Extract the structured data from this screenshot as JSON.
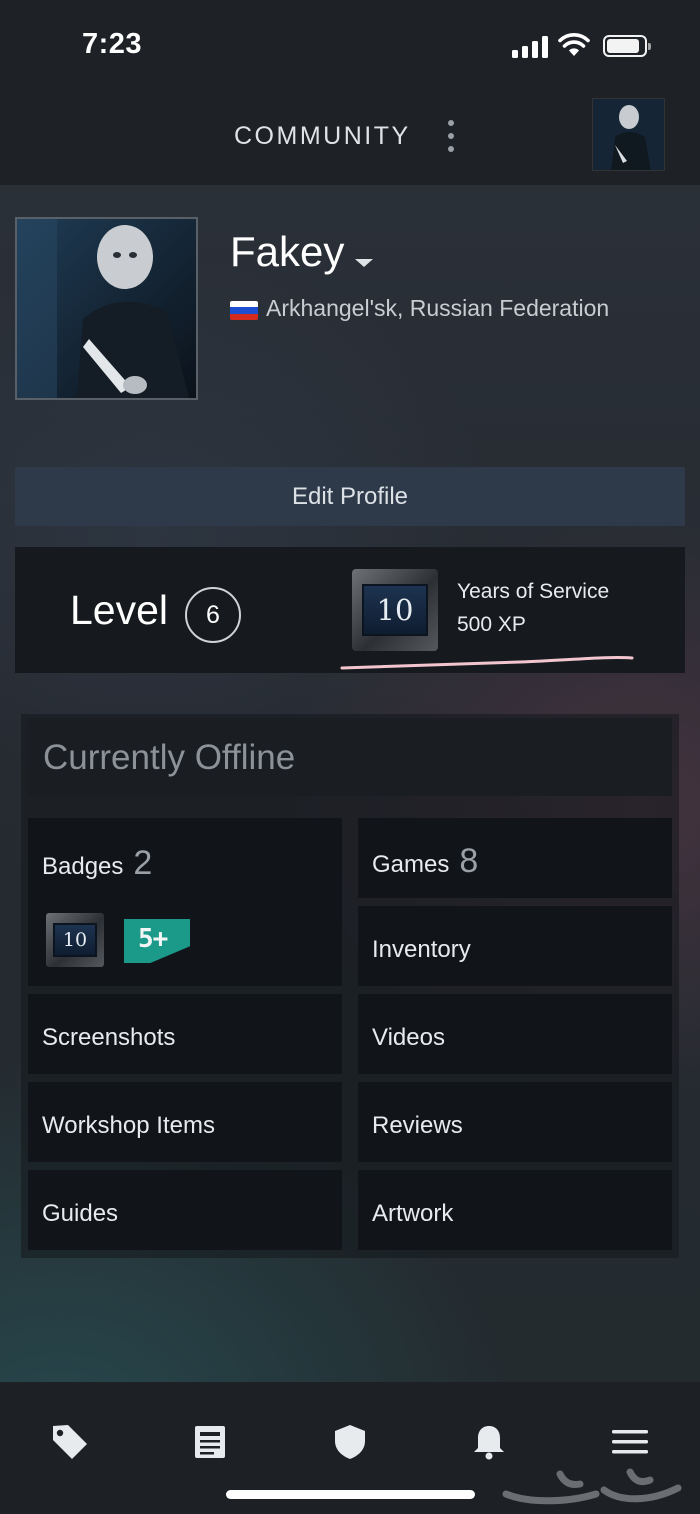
{
  "status_bar": {
    "time": "7:23",
    "signal_icon": "cellular-signal-icon",
    "wifi_icon": "wifi-icon",
    "battery_icon": "battery-icon"
  },
  "header": {
    "title": "COMMUNITY",
    "menu_icon": "kebab-menu-icon"
  },
  "profile": {
    "username": "Fakey",
    "location": "Arkhangel'sk, Russian Federation",
    "flag_colors": [
      "#ffffff",
      "#1f4fd1",
      "#d52b1e"
    ],
    "edit_button": "Edit Profile"
  },
  "level": {
    "label": "Level",
    "value": "6",
    "badge_number": "10",
    "badge_title": "Years of Service",
    "badge_xp": "500 XP"
  },
  "status": {
    "text": "Currently Offline"
  },
  "tiles": {
    "badges": {
      "label": "Badges",
      "count": "2",
      "badge_a": "10",
      "badge_b": "5+"
    },
    "games": {
      "label": "Games",
      "count": "8"
    },
    "inventory": {
      "label": "Inventory"
    },
    "screenshots": {
      "label": "Screenshots"
    },
    "videos": {
      "label": "Videos"
    },
    "workshop": {
      "label": "Workshop Items"
    },
    "reviews": {
      "label": "Reviews"
    },
    "guides": {
      "label": "Guides"
    },
    "artwork": {
      "label": "Artwork"
    }
  },
  "bottom_nav": {
    "items": [
      "tag-icon",
      "news-icon",
      "shield-icon",
      "bell-icon",
      "hamburger-menu-icon"
    ]
  },
  "colors": {
    "accent_button": "#2e3a4a",
    "tile_bg": "#111418",
    "badge_teal": "#1b9a8a",
    "annotation_pink": "#f3c6cf"
  }
}
